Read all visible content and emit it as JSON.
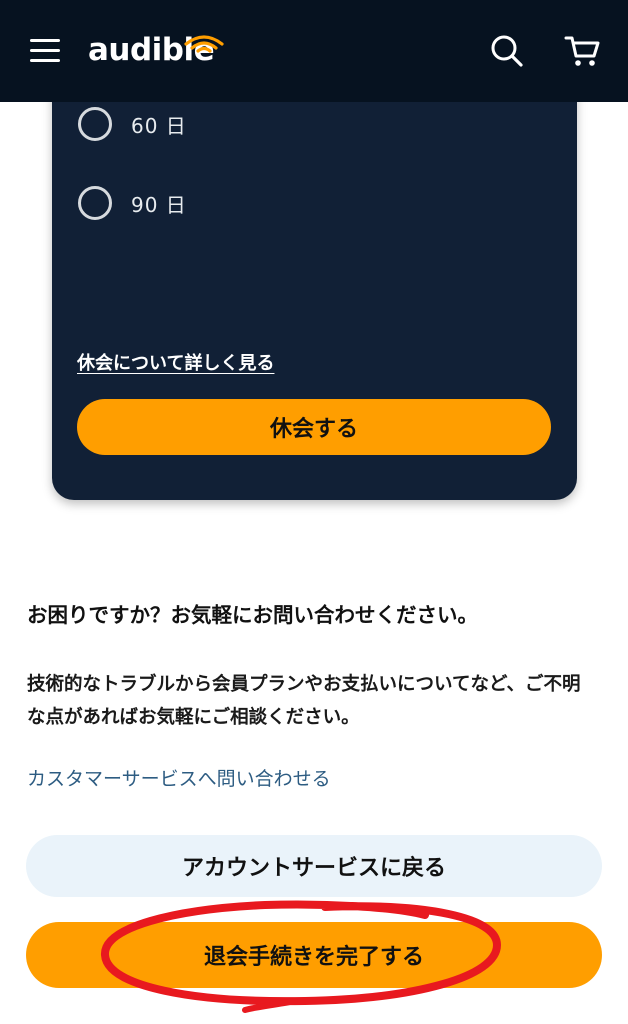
{
  "header": {
    "logo_text": "audible",
    "menu_icon": "hamburger-menu-icon",
    "search_icon": "search-icon",
    "cart_icon": "cart-icon",
    "background": "#061220"
  },
  "pause_card": {
    "options": [
      {
        "label": "60 日",
        "selected": false
      },
      {
        "label": "90 日",
        "selected": false
      }
    ],
    "learn_more_link": "休会について詳しく見る",
    "pause_button": "休会する",
    "background": "#112036"
  },
  "help": {
    "heading": "お困りですか？お気軽にお問い合わせください。",
    "body": "技術的なトラブルから会員プランやお支払いについてなど、ご不明な点があればお気軽にご相談ください。",
    "contact_link": "カスタマーサービスへ問い合わせる"
  },
  "actions": {
    "back_button": "アカウントサービスに戻る",
    "complete_button": "退会手続きを完了する"
  },
  "colors": {
    "accent_orange": "#ff9e00",
    "link_blue": "#2d5c82",
    "annotation_red": "#e8191f"
  }
}
